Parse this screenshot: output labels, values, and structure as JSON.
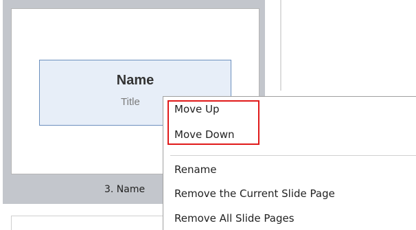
{
  "slide_panel": {
    "slide": {
      "title": "Name",
      "subtitle": "Title",
      "caption": "3. Name"
    }
  },
  "context_menu": {
    "items": [
      {
        "label": "Move Up"
      },
      {
        "label": "Move Down"
      },
      {
        "label": "Rename"
      },
      {
        "label": "Remove the Current Slide Page"
      },
      {
        "label": "Remove All Slide Pages"
      }
    ],
    "highlight_color": "#e01919"
  }
}
